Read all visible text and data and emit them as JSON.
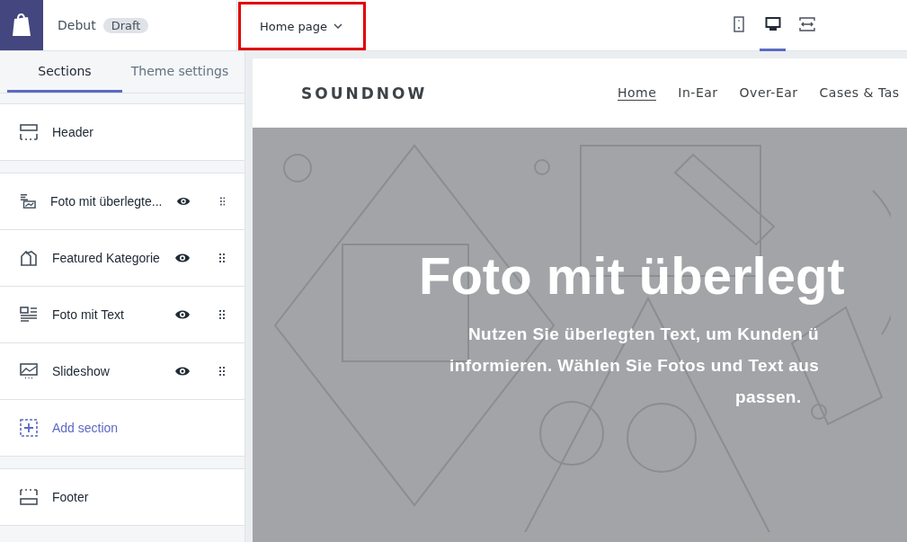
{
  "topbar": {
    "theme": "Debut",
    "badge": "Draft",
    "page_selector": "Home page",
    "devices": [
      {
        "kind": "mobile",
        "selected": false
      },
      {
        "kind": "desktop",
        "selected": true
      },
      {
        "kind": "fullscreen",
        "selected": false
      }
    ]
  },
  "sidebar": {
    "tabs": [
      {
        "label": "Sections",
        "selected": true
      },
      {
        "label": "Theme settings",
        "selected": false
      }
    ],
    "header": "Header",
    "sections": [
      {
        "label": "Foto mit überlegte...",
        "kind": "overlay",
        "visible": true
      },
      {
        "label": "Featured Kategorie",
        "kind": "collection",
        "visible": true
      },
      {
        "label": "Foto mit Text",
        "kind": "image-text",
        "visible": true
      },
      {
        "label": "Slideshow",
        "kind": "slideshow",
        "visible": true
      }
    ],
    "add_section": "Add section",
    "footer": "Footer"
  },
  "preview": {
    "logo": "SOUNDNOW",
    "nav": [
      {
        "label": "Home",
        "selected": true
      },
      {
        "label": "In-Ear",
        "selected": false
      },
      {
        "label": "Over-Ear",
        "selected": false
      },
      {
        "label": "Cases & Tas",
        "selected": false
      }
    ],
    "hero": {
      "title": "Foto mit überlegt",
      "lines": [
        "Nutzen Sie überlegten Text, um Kunden ü",
        "informieren. Wählen Sie Fotos und Text aus",
        "passen."
      ]
    }
  }
}
